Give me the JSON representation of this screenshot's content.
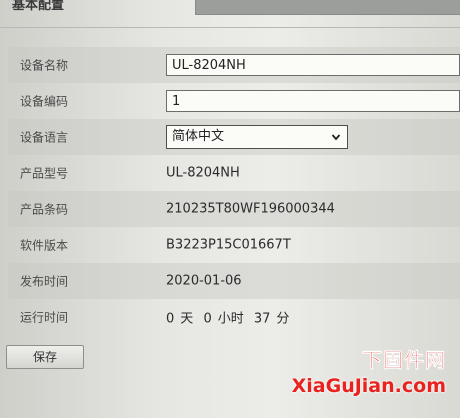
{
  "section": {
    "title": "基本配置"
  },
  "form": {
    "device_name": {
      "label": "设备名称",
      "value": "UL-8204NH"
    },
    "device_code": {
      "label": "设备编码",
      "value": "1"
    },
    "device_language": {
      "label": "设备语言",
      "value": "简体中文",
      "icon": "chevron-down-icon"
    },
    "product_model": {
      "label": "产品型号",
      "value": "UL-8204NH"
    },
    "product_barcode": {
      "label": "产品条码",
      "value": "210235T80WF196000344"
    },
    "software_version": {
      "label": "软件版本",
      "value": "B3223P15C01667T"
    },
    "release_time": {
      "label": "发布时间",
      "value": "2020-01-06"
    },
    "uptime": {
      "label": "运行时间",
      "days": "0",
      "days_unit": "天",
      "hours": "0",
      "hours_unit": "小时",
      "minutes": "37",
      "minutes_unit": "分"
    }
  },
  "actions": {
    "save_label": "保存"
  },
  "watermark": {
    "line1": "下固件网",
    "line2": "XiaGuJian.com"
  }
}
